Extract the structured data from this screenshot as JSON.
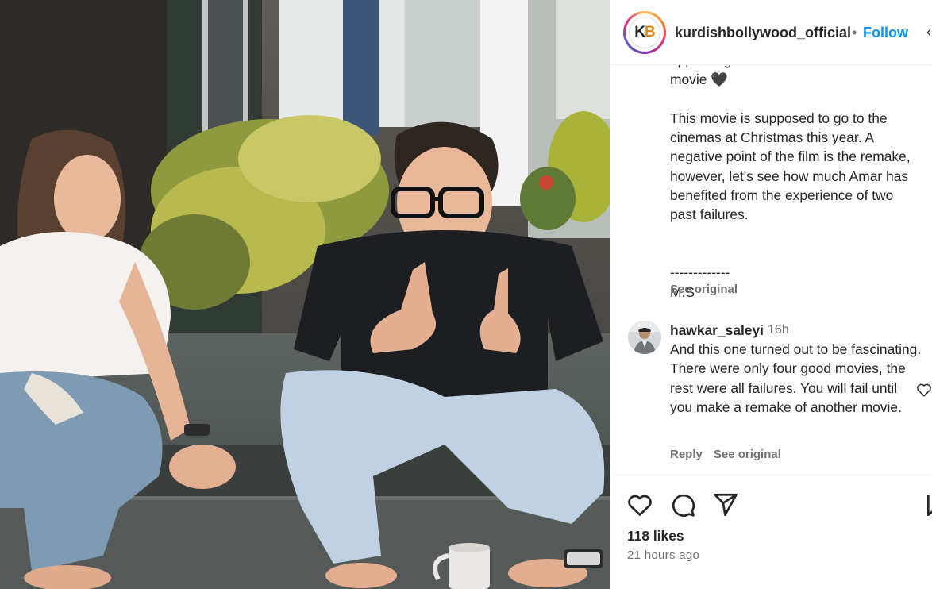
{
  "post": {
    "username": "kurdishbollywood_official",
    "separator": "•",
    "follow_label": "Follow",
    "more_icon": "more-options-icon",
    "avatar_logo_left": "K",
    "avatar_logo_right": "B"
  },
  "caption": {
    "text": "appearing in the set of Star Zamin Par\nmovie 🖤\n\nThis movie is supposed to go to the cinemas at Christmas this year. A negative point of the film is the remake, however, let's see how much Amar has benefited from the experience of two past failures.\n\n\n-------------\nM.S",
    "see_original": "See original"
  },
  "comment": {
    "username": "hawkar_saleyi",
    "time": "16h",
    "text": "And this one turned out to be fascinating. There were only four good movies, the rest were all failures. You will fail until you make a remake of another movie.",
    "reply_label": "Reply",
    "see_original": "See original"
  },
  "footer": {
    "likes": "118 likes",
    "time_ago": "21 hours ago"
  },
  "colors": {
    "follow": "#0095f6",
    "secondary_text": "#737373",
    "primary_text": "#262626"
  }
}
